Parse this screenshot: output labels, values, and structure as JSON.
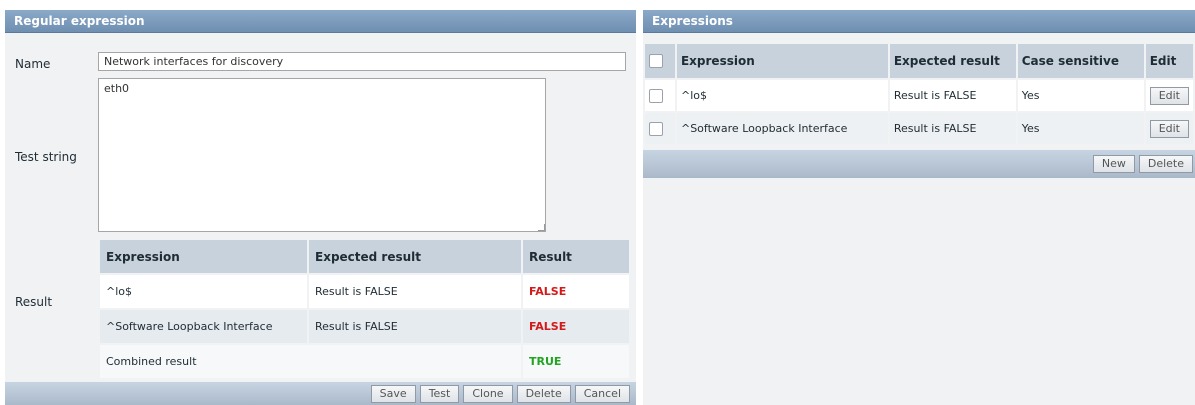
{
  "left": {
    "title": "Regular expression",
    "name_label": "Name",
    "name_value": "Network interfaces for discovery",
    "test_label": "Test string",
    "test_value": "eth0",
    "result_label": "Result",
    "result_table": {
      "headers": [
        "Expression",
        "Expected result",
        "Result"
      ],
      "rows": [
        {
          "expression": "^lo$",
          "expected": "Result is FALSE",
          "result": "FALSE"
        },
        {
          "expression": "^Software Loopback Interface",
          "expected": "Result is FALSE",
          "result": "FALSE"
        }
      ],
      "combined_label": "Combined result",
      "combined_result": "TRUE"
    },
    "buttons": {
      "save": "Save",
      "test": "Test",
      "clone": "Clone",
      "delete": "Delete",
      "cancel": "Cancel"
    }
  },
  "right": {
    "title": "Expressions",
    "headers": [
      "Expression",
      "Expected result",
      "Case sensitive",
      "Edit"
    ],
    "rows": [
      {
        "expression": "^lo$",
        "expected": "Result is FALSE",
        "case": "Yes",
        "edit": "Edit"
      },
      {
        "expression": "^Software Loopback Interface",
        "expected": "Result is FALSE",
        "case": "Yes",
        "edit": "Edit"
      }
    ],
    "buttons": {
      "new": "New",
      "delete": "Delete"
    }
  },
  "colors": {
    "false": "#d31a1a",
    "true": "#22a422",
    "header": "#7b9abd"
  }
}
